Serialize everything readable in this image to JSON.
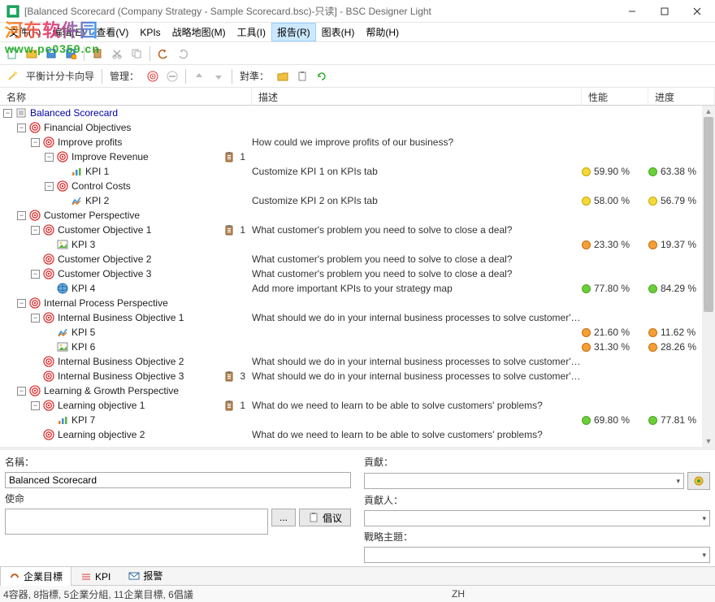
{
  "window": {
    "title": "[Balanced Scorecard (Company Strategy - Sample Scorecard.bsc)-只读] - BSC Designer Light"
  },
  "watermark": {
    "cn": "河东软件园",
    "url": "www.pc0359.cn"
  },
  "menu": {
    "file": "文件(F)",
    "edit": "编辑(E)",
    "view": "查看(V)",
    "kpis": "KPIs",
    "strategymap": "战略地图(M)",
    "tools": "工具(I)",
    "report": "报告(R)",
    "chart": "图表(H)",
    "help": "帮助(H)"
  },
  "toolbar2": {
    "wizard": "平衡计分卡向导",
    "manage": "管理：",
    "align": "對準："
  },
  "columns": {
    "name": "名称",
    "desc": "描述",
    "perf": "性能",
    "prog": "进度"
  },
  "tree": [
    {
      "depth": 0,
      "exp": "-",
      "icon": "scorecard",
      "label": "Balanced Scorecard",
      "link": true
    },
    {
      "depth": 1,
      "exp": "-",
      "icon": "target",
      "label": "Financial Objectives"
    },
    {
      "depth": 2,
      "exp": "-",
      "icon": "target",
      "label": "Improve profits",
      "desc": "How could we improve profits of our business?"
    },
    {
      "depth": 3,
      "exp": "-",
      "icon": "target",
      "label": "Improve Revenue",
      "clip": 1
    },
    {
      "depth": 4,
      "exp": ".",
      "icon": "kpi-bars",
      "label": "KPI 1",
      "desc": "Customize KPI 1 on KPIs tab",
      "perf": "59.90 %",
      "perfDot": "yellow",
      "prog": "63.38 %",
      "progDot": "green"
    },
    {
      "depth": 3,
      "exp": "-",
      "icon": "target",
      "label": "Control Costs"
    },
    {
      "depth": 4,
      "exp": ".",
      "icon": "kpi-chart",
      "label": "KPI 2",
      "desc": "Customize KPI 2 on KPIs tab",
      "perf": "58.00 %",
      "perfDot": "yellow",
      "prog": "56.79 %",
      "progDot": "yellow"
    },
    {
      "depth": 1,
      "exp": "-",
      "icon": "target",
      "label": "Customer Perspective"
    },
    {
      "depth": 2,
      "exp": "-",
      "icon": "target",
      "label": "Customer Objective 1",
      "desc": "What customer's problem you need to solve to close a deal?",
      "clip": 1
    },
    {
      "depth": 3,
      "exp": ".",
      "icon": "kpi-pic",
      "label": "KPI 3",
      "desc": "",
      "perf": "23.30 %",
      "perfDot": "orange",
      "prog": "19.37 %",
      "progDot": "orange"
    },
    {
      "depth": 2,
      "exp": ".",
      "icon": "target",
      "label": "Customer Objective 2",
      "desc": "What customer's problem you need to solve to close a deal?"
    },
    {
      "depth": 2,
      "exp": "-",
      "icon": "target",
      "label": "Customer Objective 3",
      "desc": "What customer's problem you need to solve to close a deal?"
    },
    {
      "depth": 3,
      "exp": ".",
      "icon": "kpi-globe",
      "label": "KPI 4",
      "desc": "Add more important KPIs to your strategy map",
      "perf": "77.80 %",
      "perfDot": "green",
      "prog": "84.29 %",
      "progDot": "green"
    },
    {
      "depth": 1,
      "exp": "-",
      "icon": "target",
      "label": "Internal Process Perspective"
    },
    {
      "depth": 2,
      "exp": "-",
      "icon": "target",
      "label": "Internal Business Objective 1",
      "desc": "What should we do in your internal business processes to solve customer's ..."
    },
    {
      "depth": 3,
      "exp": ".",
      "icon": "kpi-chart",
      "label": "KPI 5",
      "desc": "",
      "perf": "21.60 %",
      "perfDot": "orange",
      "prog": "11.62 %",
      "progDot": "orange"
    },
    {
      "depth": 3,
      "exp": ".",
      "icon": "kpi-pic",
      "label": "KPI 6",
      "desc": "",
      "perf": "31.30 %",
      "perfDot": "orange",
      "prog": "28.26 %",
      "progDot": "orange"
    },
    {
      "depth": 2,
      "exp": ".",
      "icon": "target",
      "label": "Internal Business Objective 2",
      "desc": "What should we do in your internal business processes to solve customer's ..."
    },
    {
      "depth": 2,
      "exp": ".",
      "icon": "target",
      "label": "Internal Business Objective 3",
      "clip": 3,
      "desc": "What should we do in your internal business processes to solve customer's ..."
    },
    {
      "depth": 1,
      "exp": "-",
      "icon": "target",
      "label": "Learning & Growth Perspective"
    },
    {
      "depth": 2,
      "exp": "-",
      "icon": "target",
      "label": "Learning objective 1",
      "desc": "What do we need to learn to be able to solve customers' problems?",
      "clip": 1
    },
    {
      "depth": 3,
      "exp": ".",
      "icon": "kpi-bars",
      "label": "KPI 7",
      "desc": "",
      "perf": "69.80 %",
      "perfDot": "green",
      "prog": "77.81 %",
      "progDot": "green"
    },
    {
      "depth": 2,
      "exp": ".",
      "icon": "target",
      "label": "Learning objective 2",
      "desc": "What do we need to learn to be able to solve customers' problems?"
    }
  ],
  "detail": {
    "name_label": "名稱：",
    "name_value": "Balanced Scorecard",
    "mission_label": "使命",
    "contribution_label": "貢獻：",
    "contributor_label": "貢獻人：",
    "theme_label": "戰略主題：",
    "browse": "...",
    "initiative_btn": "倡议"
  },
  "tabs": {
    "objectives": "企業目標",
    "kpi": "KPI",
    "alerts": "报警"
  },
  "statusbar": {
    "left": "4容器, 8指標, 5企業分組, 11企業目標, 6倡議",
    "center": "ZH"
  }
}
